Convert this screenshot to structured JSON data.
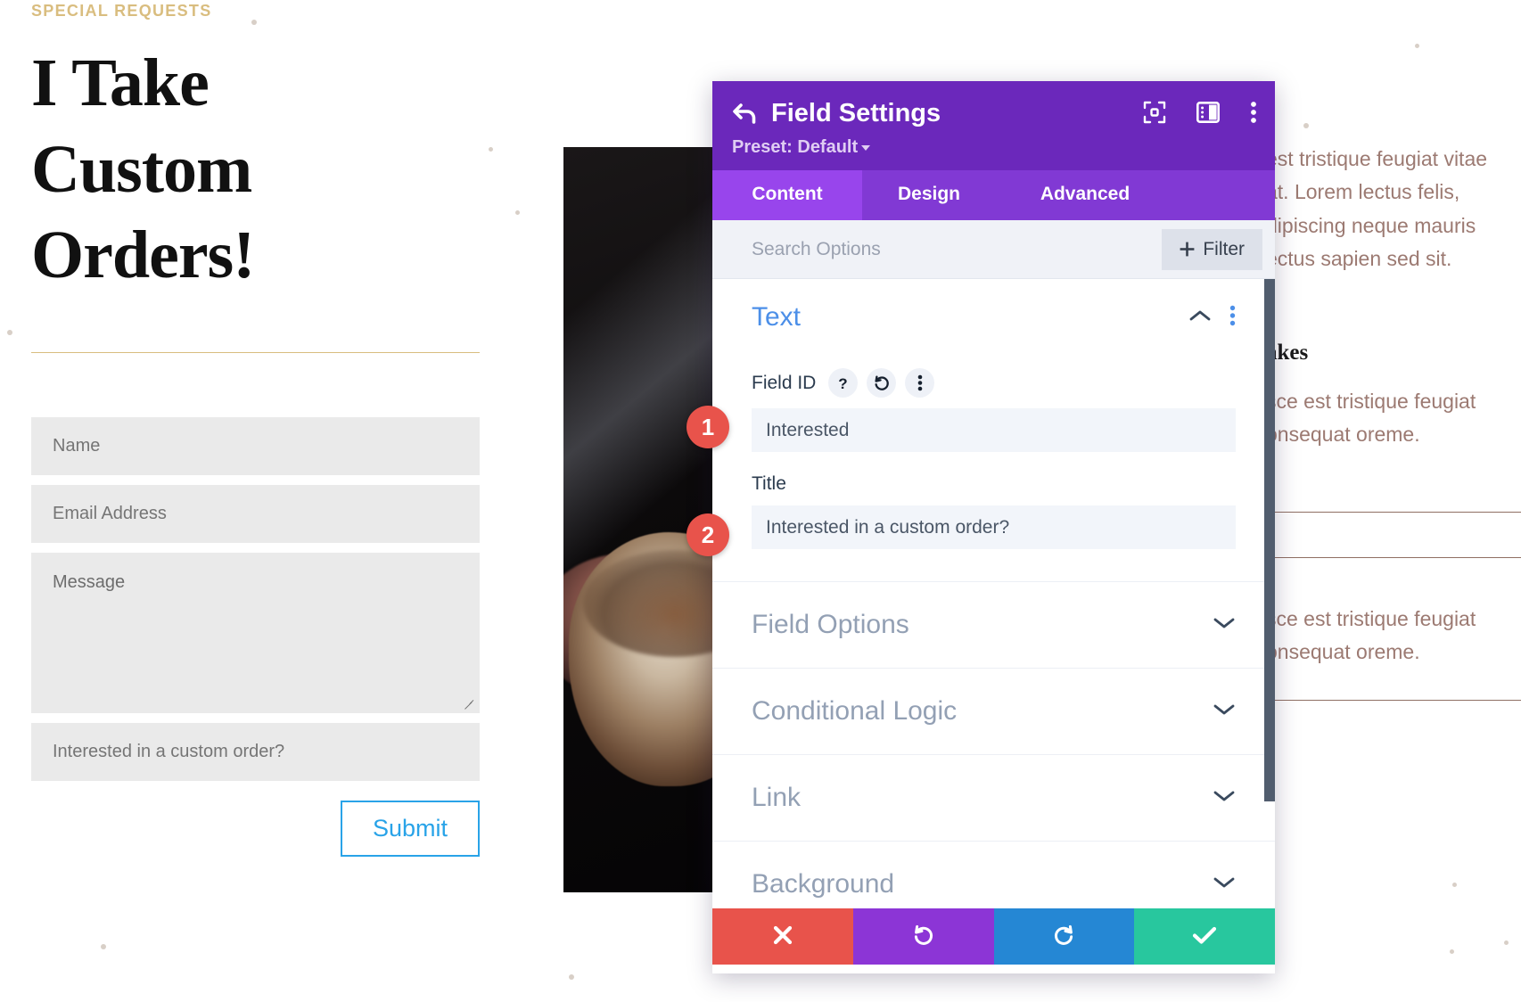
{
  "site": {
    "eyebrow": "SPECIAL REQUESTS",
    "headline": "I Take Custom Orders!",
    "form": {
      "name_placeholder": "Name",
      "email_placeholder": "Email Address",
      "message_placeholder": "Message",
      "custom_placeholder": "Interested in a custom order?",
      "submit_label": "Submit"
    },
    "right_column": {
      "paragraph_top": "est tristique feugiat vitae\nat. Lorem lectus felis,\ndipiscing neque mauris\nectus sapien sed sit.",
      "card_heading": "akes",
      "card_para_1": "sce est tristique feugiat\nonsequat oreme.",
      "card_para_2": "sce est tristique feugiat\nonsequat oreme."
    }
  },
  "modal": {
    "title": "Field Settings",
    "back_icon": "back-arrow-icon",
    "preset_label": "Preset: Default",
    "header_icons": [
      "focus-target-icon",
      "panel-layout-icon",
      "kebab-menu-icon"
    ],
    "tabs": [
      {
        "label": "Content",
        "active": true
      },
      {
        "label": "Design",
        "active": false
      },
      {
        "label": "Advanced",
        "active": false
      }
    ],
    "search": {
      "placeholder": "Search Options",
      "value": "",
      "filter_label": "Filter"
    },
    "section": {
      "title": "Text",
      "collapse_icon": "chevron-up-icon",
      "menu_icon": "kebab-menu-icon",
      "field_id_label": "Field ID",
      "field_id_icons": [
        "help-icon",
        "reset-icon",
        "kebab-menu-icon"
      ],
      "field_id_value": "Interested",
      "title_label": "Title",
      "title_value": "Interested in a custom order?"
    },
    "accordions": [
      {
        "label": "Field Options",
        "icon": "chevron-down-icon"
      },
      {
        "label": "Conditional Logic",
        "icon": "chevron-down-icon"
      },
      {
        "label": "Link",
        "icon": "chevron-down-icon"
      },
      {
        "label": "Background",
        "icon": "chevron-down-icon"
      }
    ],
    "footer_buttons": [
      {
        "name": "cancel",
        "icon": "close-x-icon",
        "color": "#e8534b"
      },
      {
        "name": "undo",
        "icon": "undo-arrow-icon",
        "color": "#8c35d6"
      },
      {
        "name": "redo",
        "icon": "redo-arrow-icon",
        "color": "#2587d4"
      },
      {
        "name": "save",
        "icon": "checkmark-icon",
        "color": "#28c79e"
      }
    ],
    "colors": {
      "header": "#6b28bb",
      "tabbar": "#8139d4",
      "tab_active": "#9845ec",
      "section_title": "#4c8fe8",
      "accent_gold": "#d9bd7f"
    }
  },
  "annotations": [
    {
      "number": "1",
      "target": "field-id-input"
    },
    {
      "number": "2",
      "target": "title-input"
    }
  ]
}
